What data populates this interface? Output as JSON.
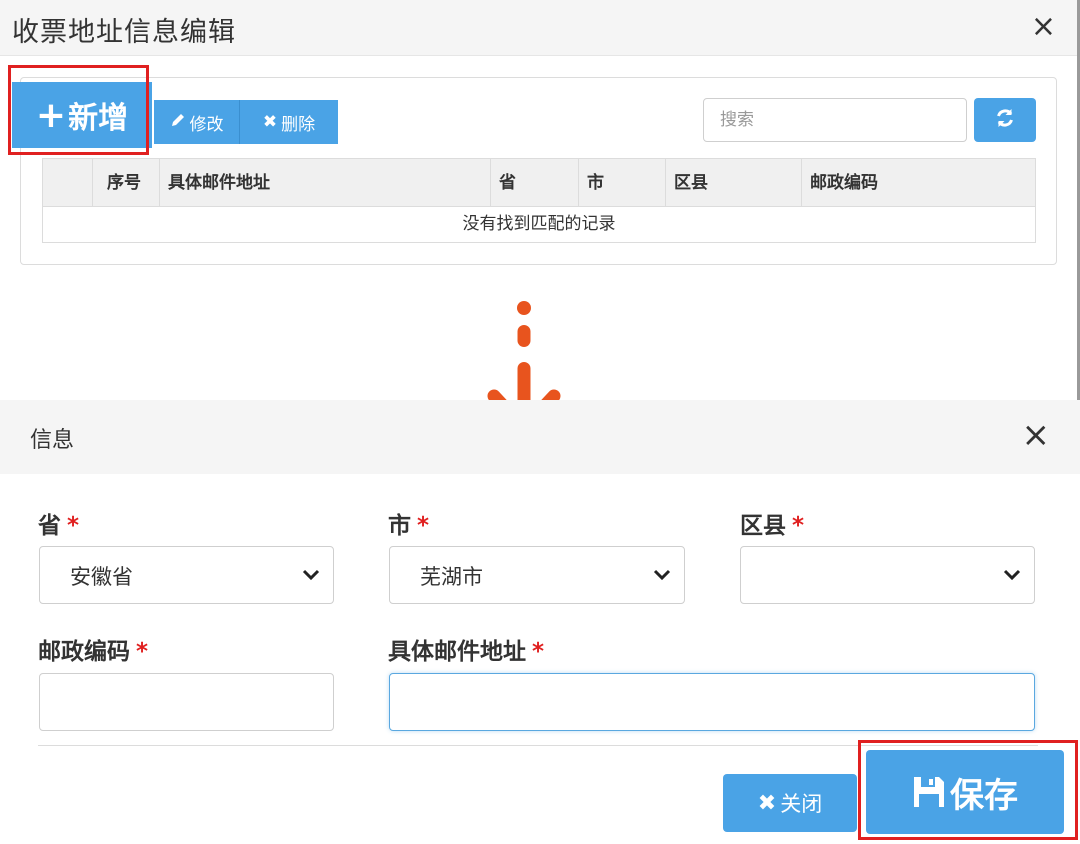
{
  "top_dialog": {
    "title": "收票地址信息编辑",
    "close_glyph": "×",
    "toolbar": {
      "add_label": "新增",
      "edit_label": "修改",
      "delete_label": "删除"
    },
    "search": {
      "placeholder": "搜索"
    },
    "table": {
      "columns": [
        "",
        "序号",
        "具体邮件地址",
        "省",
        "市",
        "区县",
        "邮政编码"
      ],
      "empty_message": "没有找到匹配的记录"
    }
  },
  "bottom_dialog": {
    "title": "信息",
    "close_glyph": "×",
    "fields": {
      "province": {
        "label": "省",
        "required_mark": "*",
        "value": "安徽省"
      },
      "city": {
        "label": "市",
        "required_mark": "*",
        "value": "芜湖市"
      },
      "district": {
        "label": "区县",
        "required_mark": "*",
        "value": ""
      },
      "postcode": {
        "label": "邮政编码",
        "required_mark": "*",
        "value": ""
      },
      "address": {
        "label": "具体邮件地址",
        "required_mark": "*",
        "value": ""
      }
    },
    "buttons": {
      "close_label": "关闭",
      "save_label": "保存"
    }
  },
  "colors": {
    "primary_button": "#4aa3e6",
    "highlight_box": "#e02020",
    "arrow": "#e8541e",
    "required_mark": "#e02020"
  },
  "icons": {
    "add": "plus-icon",
    "edit": "pencil-icon",
    "delete": "x-icon",
    "refresh": "refresh-icon",
    "close_button": "x-icon",
    "save": "floppy-disk-icon",
    "select": "chevron-down-icon",
    "flow": "arrow-down-icon"
  }
}
